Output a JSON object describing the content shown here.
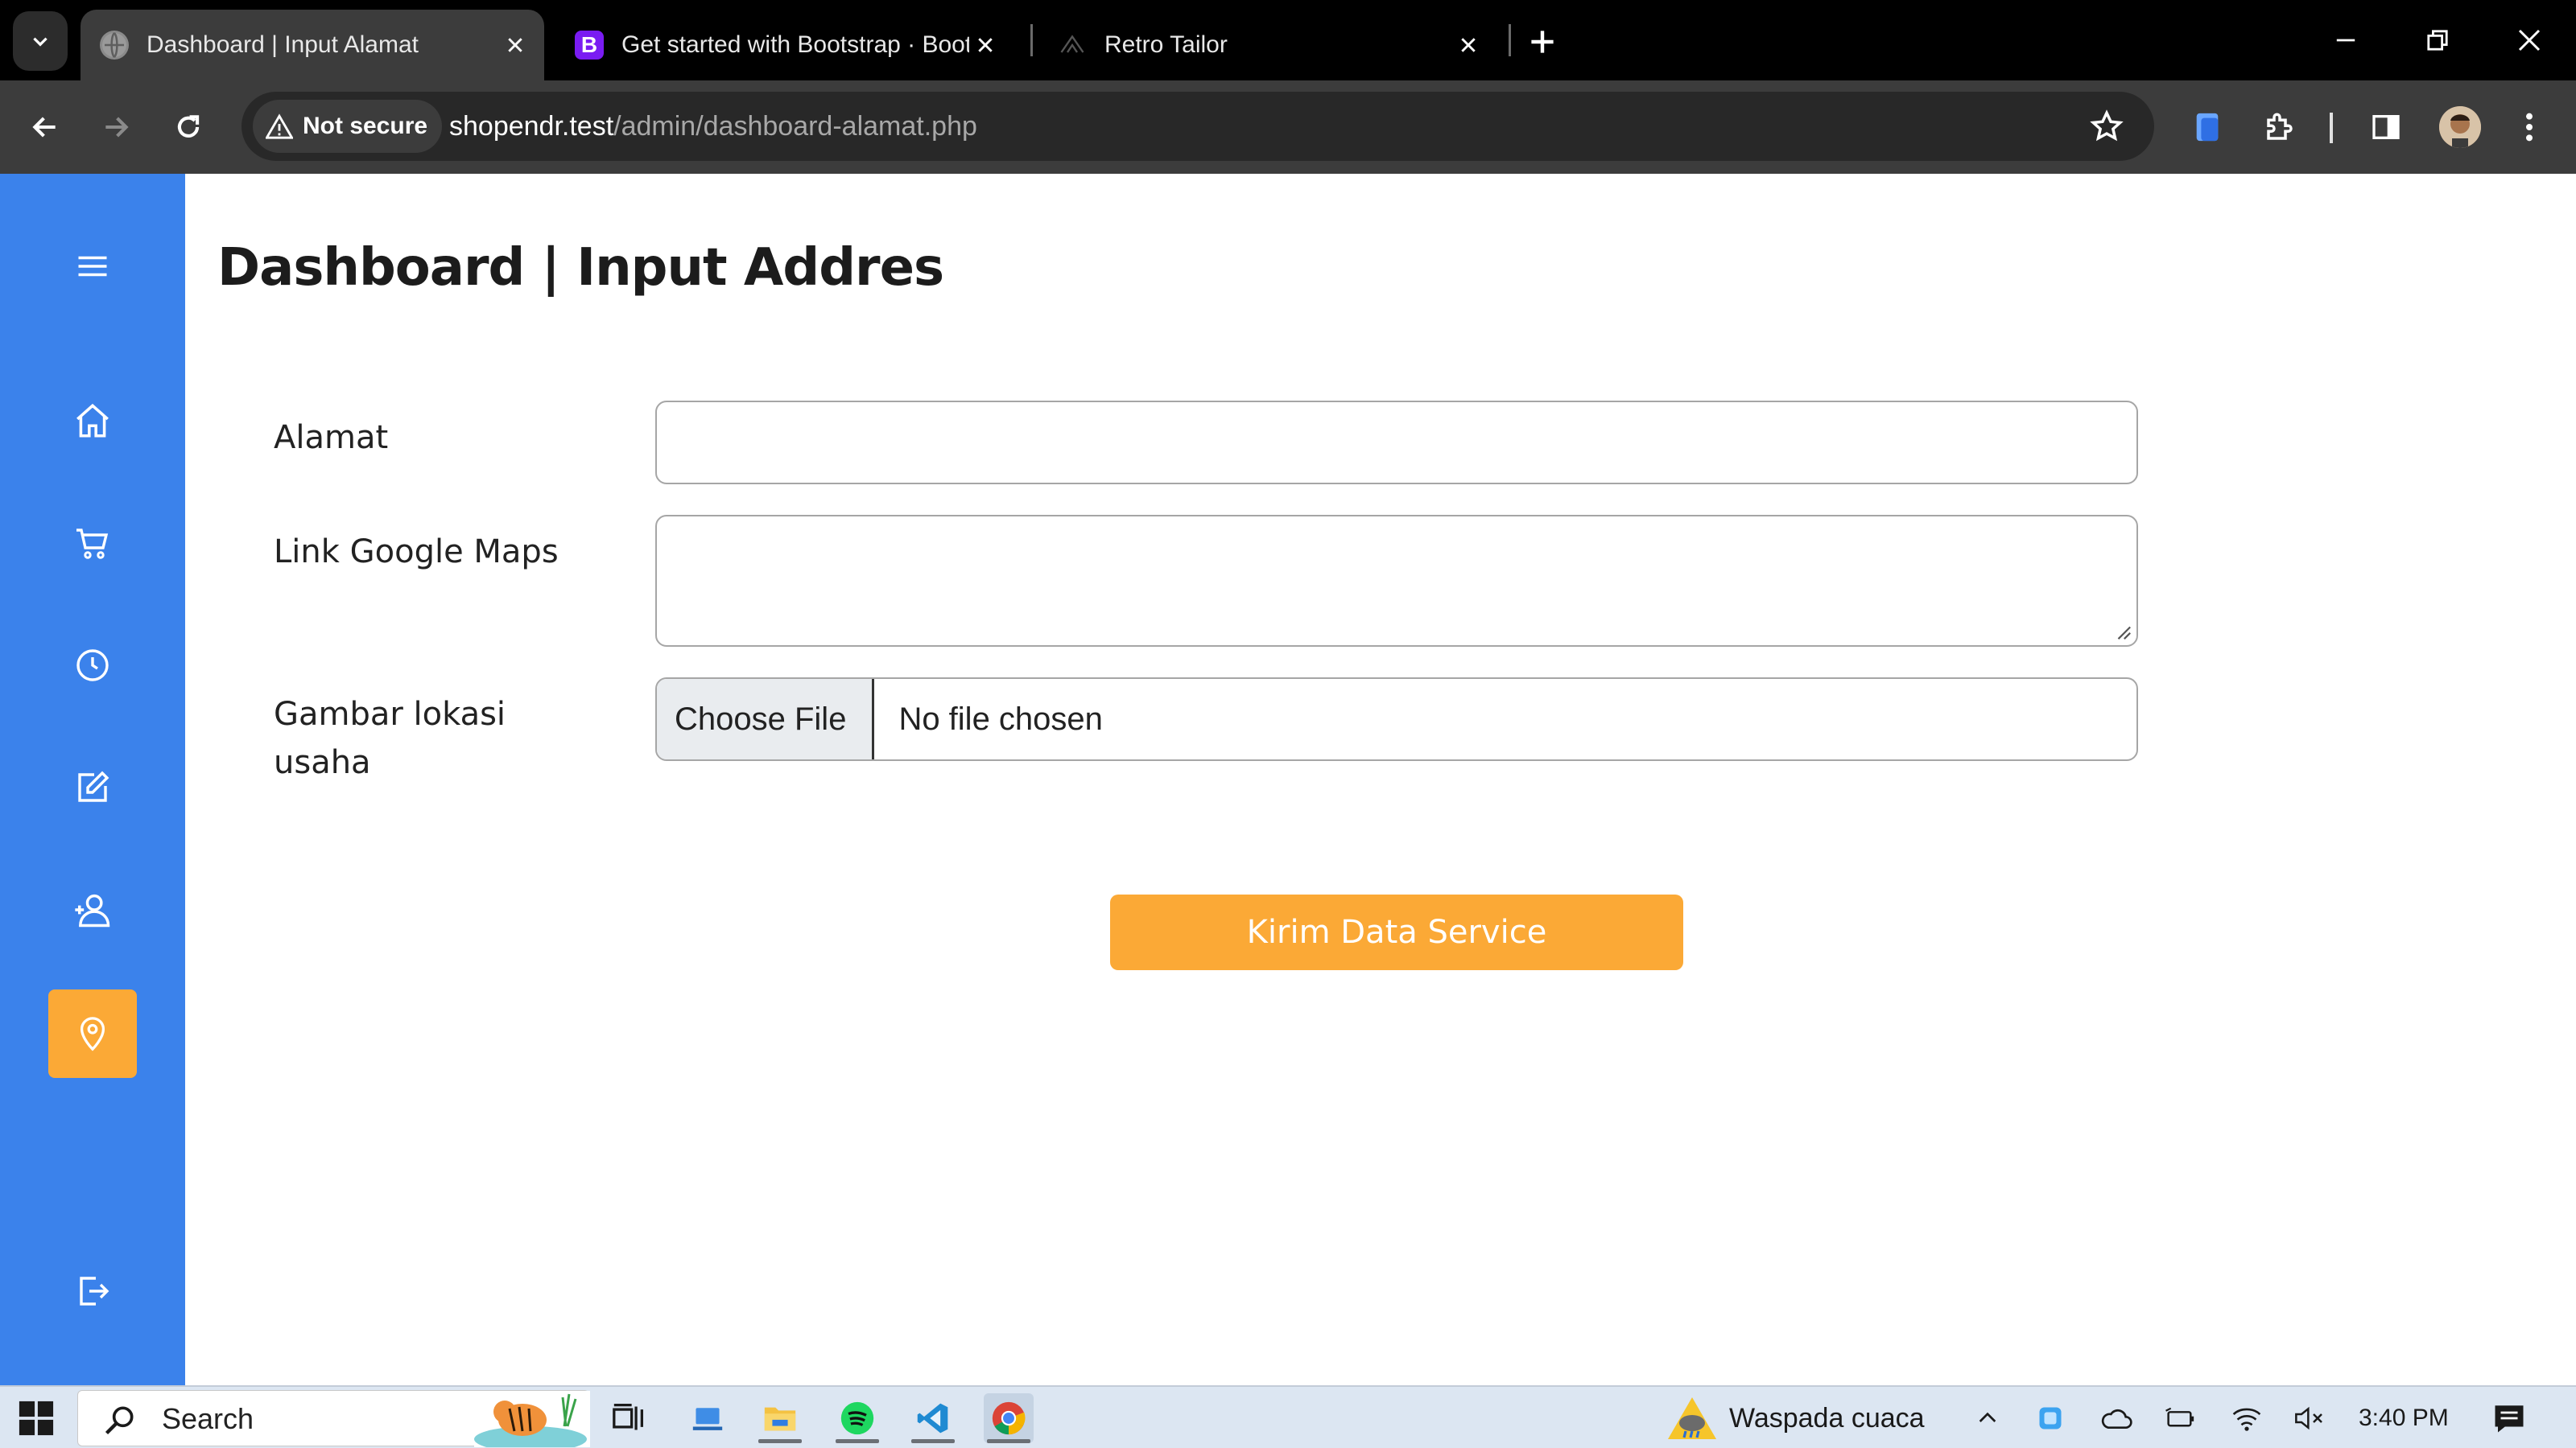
{
  "browser": {
    "tabs": [
      {
        "title": "Dashboard | Input Alamat",
        "active": true,
        "favicon": "globe-icon"
      },
      {
        "title": "Get started with Bootstrap · Bootstrap",
        "active": false,
        "favicon": "bootstrap-icon",
        "favicon_letter": "B",
        "favicon_color": "#7a1cf2"
      },
      {
        "title": "Retro Tailor",
        "active": false,
        "favicon": "retro-tailor-icon"
      }
    ],
    "security_label": "Not secure",
    "url_host": "shopendr.test",
    "url_path": "/admin/dashboard-alamat.php"
  },
  "page": {
    "title": "Dashboard | Input Addres",
    "form": {
      "alamat_label": "Alamat",
      "alamat_value": "",
      "maps_label": "Link Google Maps",
      "maps_value": "",
      "gambar_label_line1": "Gambar lokasi",
      "gambar_label_line2": "usaha",
      "file_button": "Choose File",
      "file_status": "No file chosen",
      "submit_label": "Kirim Data Service"
    }
  },
  "sidebar": {
    "items": [
      {
        "name": "menu-icon"
      },
      {
        "name": "home-icon"
      },
      {
        "name": "cart-icon"
      },
      {
        "name": "history-icon"
      },
      {
        "name": "edit-icon"
      },
      {
        "name": "user-add-icon"
      },
      {
        "name": "location-icon",
        "active": true
      },
      {
        "name": "logout-icon"
      }
    ]
  },
  "taskbar": {
    "search_label": "Search",
    "weather_label": "Waspada cuaca",
    "clock": "3:40 PM"
  },
  "colors": {
    "sidebar": "#3b82eb",
    "accent": "#fba936",
    "browser_frame": "#000000",
    "toolbar": "#3c3c3c"
  }
}
